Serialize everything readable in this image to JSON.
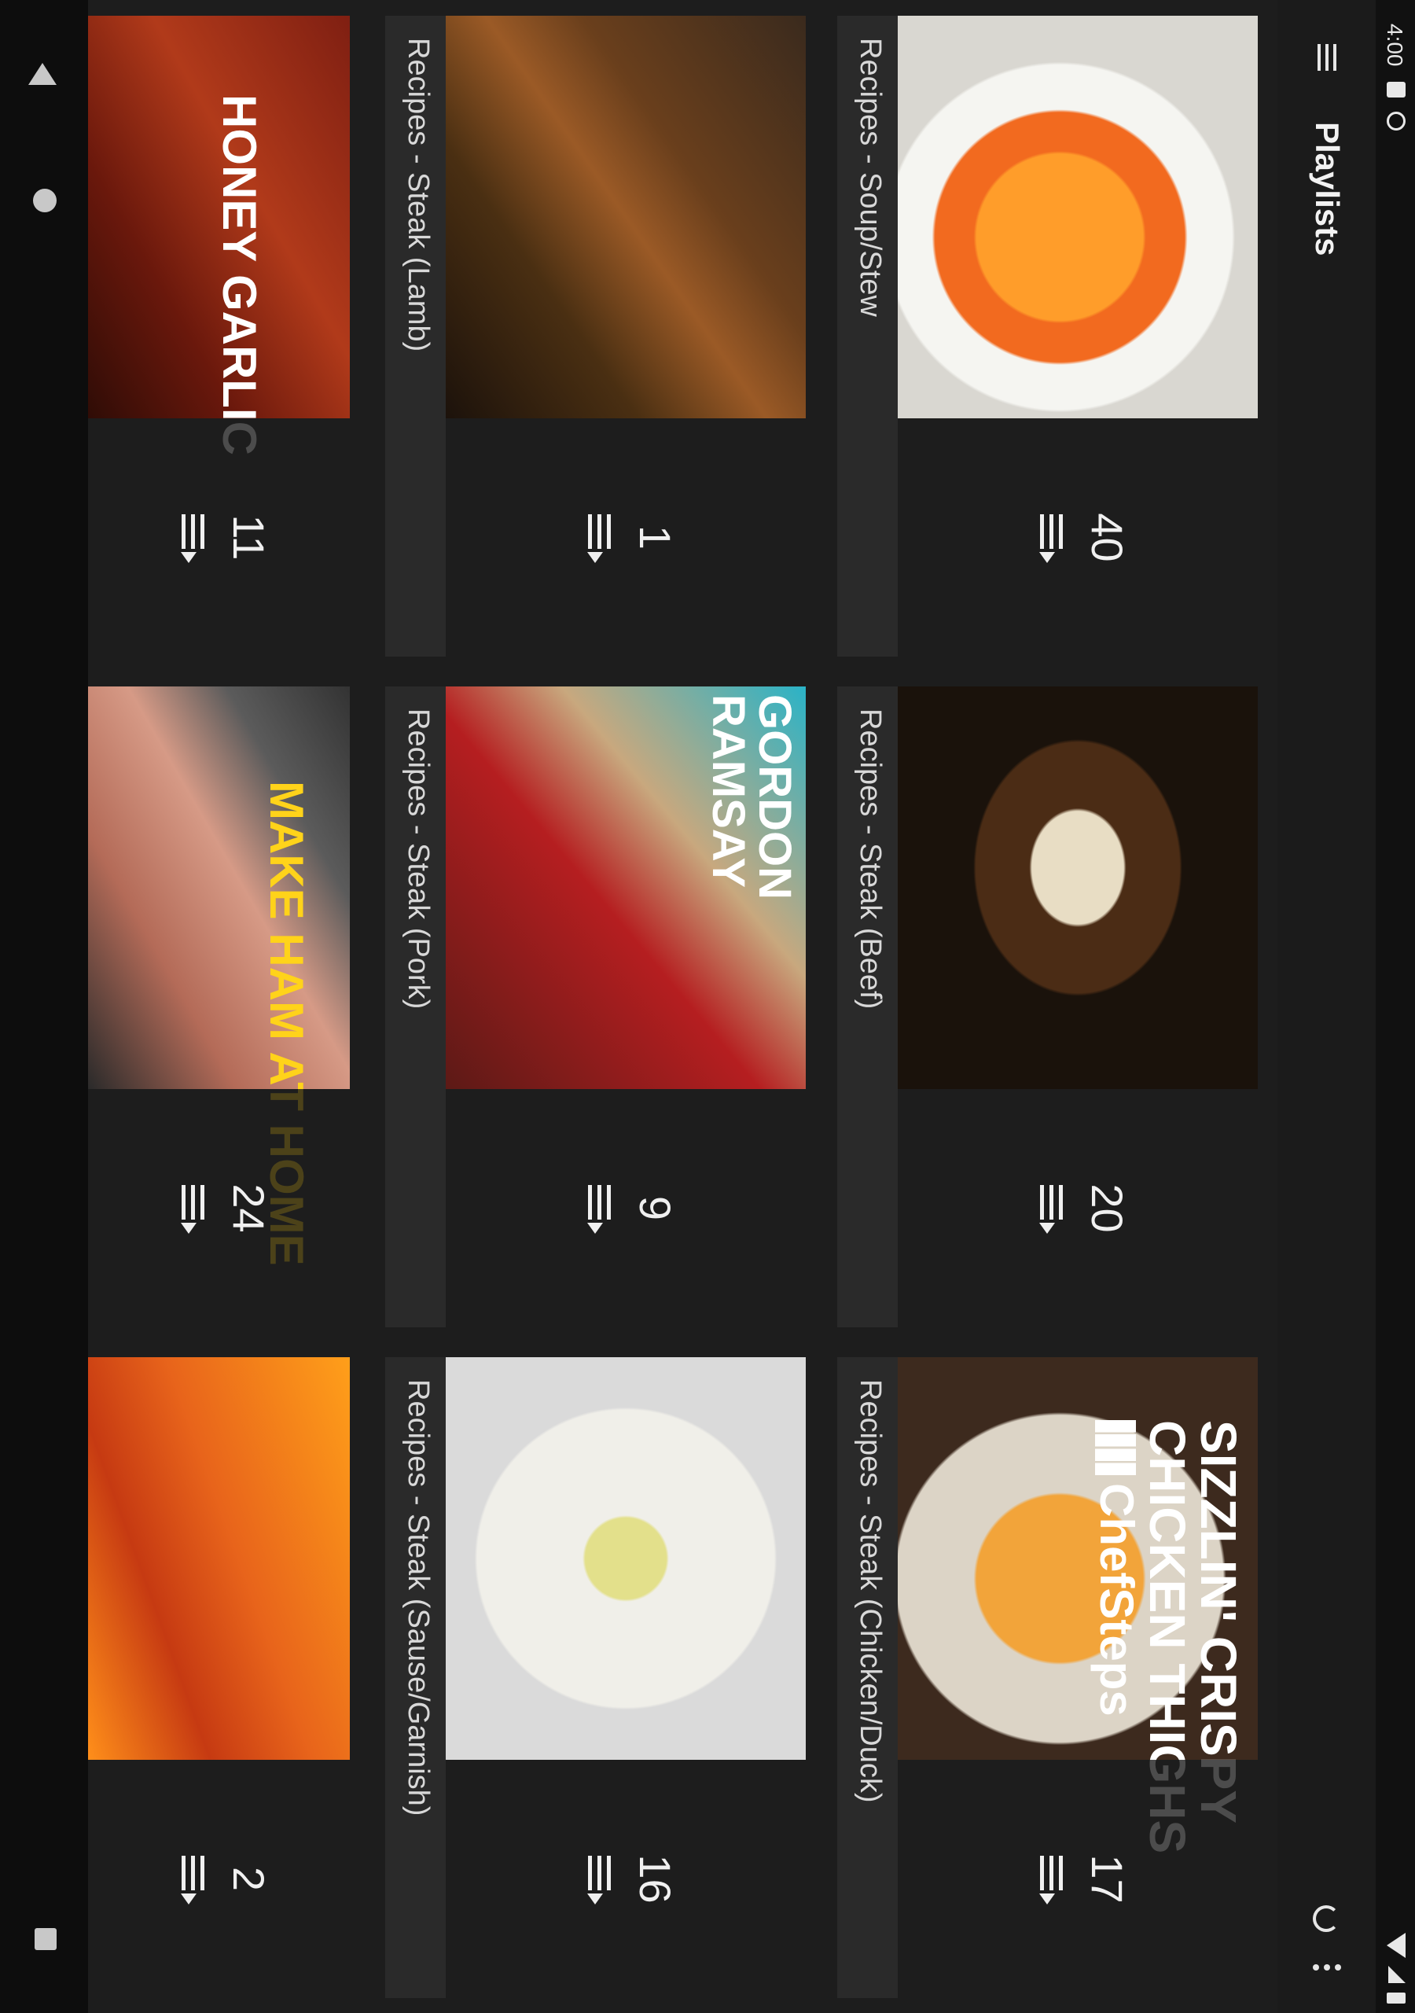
{
  "status": {
    "time": "4:00"
  },
  "appbar": {
    "title": "Playlists"
  },
  "cards": [
    {
      "title": "Recipes - Soup/Stew",
      "count": "40",
      "overlay_text": ""
    },
    {
      "title": "Recipes - Steak (Beef)",
      "count": "20",
      "overlay_text": ""
    },
    {
      "title": "Recipes - Steak (Chicken/Duck)",
      "count": "17",
      "overlay_text": "SIZZLIN' CRISPY CHICKEN THIGHS",
      "brand": "ChefSteps"
    },
    {
      "title": "Recipes - Steak (Lamb)",
      "count": "1",
      "overlay_text": ""
    },
    {
      "title": "Recipes - Steak (Pork)",
      "count": "9",
      "overlay_text": "GORDON RAMSAY"
    },
    {
      "title": "Recipes - Steak (Sause/Garnish)",
      "count": "16",
      "overlay_text": ""
    },
    {
      "title": "",
      "count": "11",
      "overlay_text": "HONEY GARLIC"
    },
    {
      "title": "",
      "count": "24",
      "overlay_text": "MAKE HAM AT HOME"
    },
    {
      "title": "",
      "count": "2",
      "overlay_text": ""
    }
  ],
  "icons": {
    "menu": "hamburger-menu-icon",
    "refresh": "refresh-icon",
    "more": "more-vert-icon",
    "playlist": "playlist-play-icon",
    "back": "back-triangle-icon",
    "home": "home-circle-icon",
    "recent": "recent-square-icon"
  }
}
